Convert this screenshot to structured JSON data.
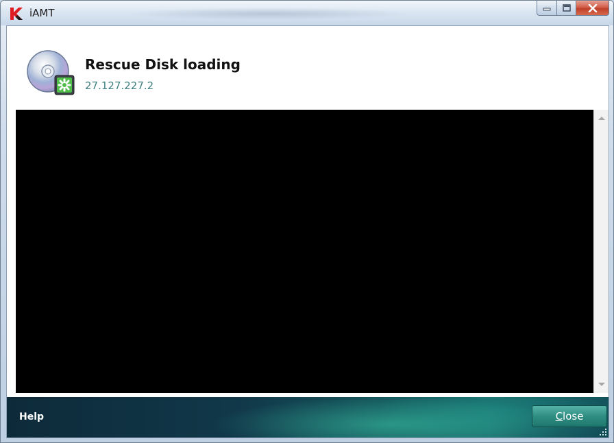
{
  "window": {
    "title": "iAMT",
    "minimize_label": "",
    "maximize_label": "",
    "close_label": ""
  },
  "header": {
    "title": "Rescue Disk loading",
    "address": "27.127.227.2"
  },
  "footer": {
    "help_label": "Help",
    "close_button": {
      "mnemonic": "C",
      "rest": "lose"
    }
  },
  "colors": {
    "console_background": "#000000",
    "footer_accent": "#2f8e82",
    "logo_red": "#e11b22"
  },
  "icons": {
    "app": "kaspersky-k-icon",
    "header": "rescue-disc-icon",
    "minimize": "minimize-icon",
    "maximize": "maximize-icon",
    "close": "close-x-icon"
  }
}
